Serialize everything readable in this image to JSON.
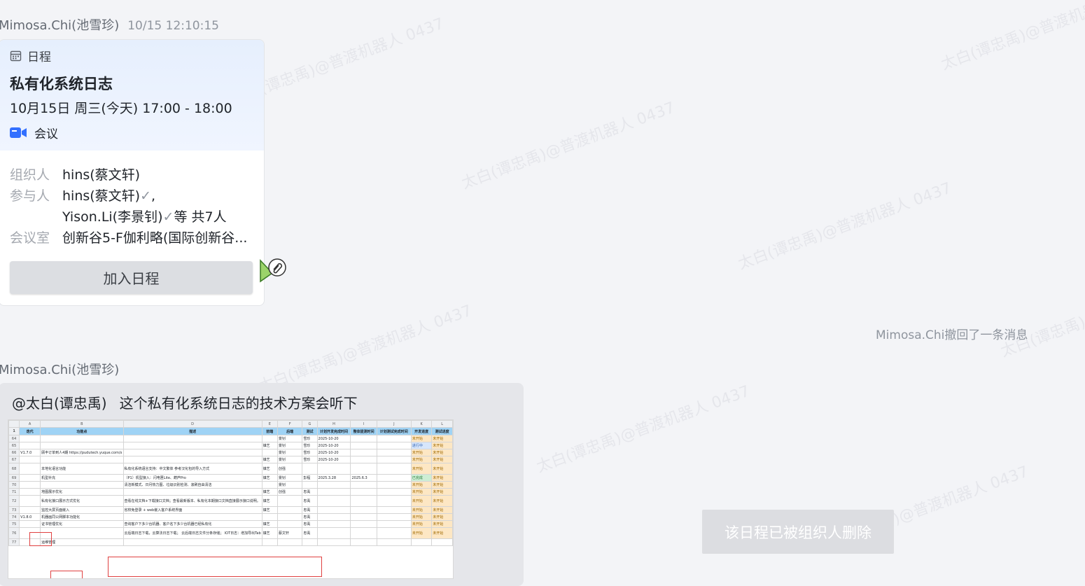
{
  "watermark": "太白(谭忠禹)@普渡机器人 0437",
  "message1": {
    "sender": "Mimosa.Chi(池雪珍)",
    "time": "10/15 12:10:15"
  },
  "calendar": {
    "type_label": "日程",
    "title": "私有化系统日志",
    "time_range": "10月15日 周三(今天) 17:00 - 18:00",
    "meeting_label": "会议",
    "organizer_label": "组织人",
    "organizer": "hins(蔡文轩)",
    "participants_label": "参与人",
    "participant_1": "hins(蔡文轩)",
    "participant_1_suffix": ",",
    "participant_2": "Yison.Li(李景钊)",
    "participant_more": "等 共7人",
    "room_label": "会议室",
    "room": "创新谷5-F伽利略(国际创新谷...",
    "join_button": "加入日程",
    "colors": {
      "header_bg": "#e6effd",
      "meeting_icon": "#3370ff"
    }
  },
  "recall_notice": "Mimosa.Chi撤回了一条消息",
  "message2": {
    "sender": "Mimosa.Chi(池雪珍)",
    "mention": "@太白(谭忠禹)",
    "text": "这个私有化系统日志的技术方案会听下"
  },
  "sheet": {
    "col_letters": [
      "",
      "A",
      "B",
      "D",
      "E",
      "F",
      "G",
      "H",
      "I",
      "J",
      "K",
      "L"
    ],
    "headers": [
      "1",
      "迭代",
      "功能点",
      "描述",
      "前端",
      "后端",
      "测试",
      "计划开发完成时间",
      "整体提测时间",
      "计划测试完成时间",
      "开发进度",
      "测试进度"
    ],
    "rows": [
      [
        "64",
        "",
        "",
        "",
        "",
        "景钊",
        "雪珍",
        "2025-10-20",
        "",
        "",
        "未开始",
        "未开始"
      ],
      [
        "65",
        "",
        "",
        "",
        "镇艺",
        "景钊",
        "雪珍",
        "2025-10-20",
        "",
        "",
        "进行中",
        "未开始"
      ],
      [
        "66",
        "V1.7.0",
        "顾丰订单到人4期 https://pudutech.yuque.com/x",
        "",
        "",
        "景钊",
        "雪珍",
        "2025-10-20",
        "",
        "",
        "未开始",
        "未开始"
      ],
      [
        "67",
        "",
        "",
        "",
        "镇艺",
        "景钊",
        "雪珍",
        "2025-10-20",
        "",
        "",
        "未开始",
        "未开始"
      ],
      [
        "68",
        "",
        "本地化语言功能",
        "私有化系统语言支持：中文繁体 参考汉化包的导入方式",
        "镇艺",
        "创强",
        "",
        "",
        "",
        "",
        "未开始",
        "未开始"
      ],
      [
        "69",
        "",
        "机型补充",
        "（P1）机型接入：闪电匣Lite、葫芦Pro",
        "镇艺",
        "景钊",
        "彭程",
        "2025.3.28",
        "2025.6.3",
        "",
        "已完成",
        "未开始"
      ],
      [
        "70",
        "",
        "",
        "清洁新模式、日月热力图、垃圾识别检测、滚刷自由清洁",
        "",
        "景钊",
        "",
        "",
        "",
        "",
        "未开始",
        "未开始"
      ],
      [
        "71",
        "",
        "地图展示优化",
        "",
        "镇艺",
        "创强",
        "忠禹",
        "",
        "",
        "",
        "未开始",
        "未开始"
      ],
      [
        "72",
        "",
        "私有化接口展示方式优化",
        "查看在线文档+下载接口文档；查看最新版本、私有化本期接口文档直接展示接口说明。",
        "镇艺",
        "",
        "忠禹",
        "",
        "",
        "",
        "未开始",
        "未开始"
      ],
      [
        "73",
        "",
        "监控大屏页面嵌入",
        "省校免登录 + web嵌入客户系统界面",
        "镇艺",
        "",
        "忠禹",
        "",
        "",
        "",
        "未开始",
        "未开始"
      ],
      [
        "74",
        "V1.8.0",
        "机器画同公网脚本功能化",
        "",
        "",
        "",
        "忠禹",
        "",
        "",
        "",
        "未开始",
        "未开始"
      ],
      [
        "75",
        "",
        "证书管理优化",
        "查询客户下多少台机器、客户名下多少台机器已经私有化",
        "镇艺",
        "",
        "忠禹",
        "",
        "",
        "",
        "未开始",
        "未开始"
      ],
      [
        "76",
        "",
        "",
        "云后端日志下载，云算法日志下载； 云后端日志文件分条存储； IOT日志：增加导出Tab",
        "镇艺",
        "蔡文轩",
        "忠禹",
        "",
        "",
        "",
        "未开始",
        "未开始"
      ],
      [
        "77",
        "",
        "运维管理",
        "",
        "",
        "",
        "",
        "",
        "",
        "",
        "",
        ""
      ]
    ]
  },
  "deleted_notice_button": "该日程已被组织人删除"
}
